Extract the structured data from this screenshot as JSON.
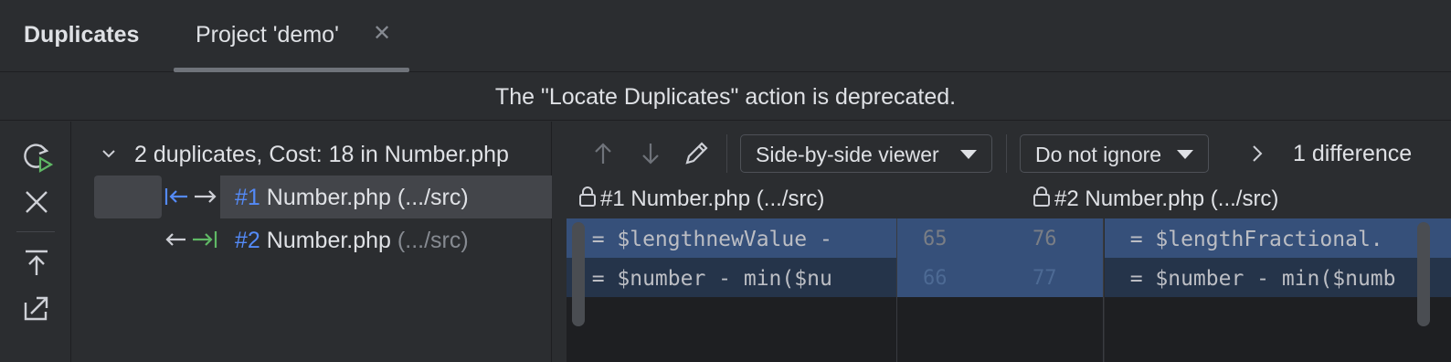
{
  "tool_window": {
    "title": "Duplicates",
    "tab": {
      "label": "Project 'demo'",
      "close_icon": "close-icon"
    }
  },
  "banner": {
    "text": "The \"Locate Duplicates\" action is deprecated."
  },
  "left_toolbar": {
    "icons": [
      "rerun-icon",
      "close-icon",
      "export-icon",
      "open-external-icon"
    ]
  },
  "tree": {
    "root": {
      "label": "2 duplicates, Cost: 18 in Number.php",
      "expanded": true
    },
    "items": [
      {
        "number": "#1",
        "file": "Number.php",
        "path": "(.../src)",
        "selected": true
      },
      {
        "number": "#2",
        "file": "Number.php",
        "path": "(.../src)",
        "selected": false
      }
    ]
  },
  "diff": {
    "toolbar": {
      "viewer": "Side-by-side viewer",
      "ignore": "Do not ignore",
      "count": "1 difference"
    },
    "left": {
      "header": "#1 Number.php (.../src)",
      "lines": [
        "  = $lengthnewValue - ",
        "  = $number - min($nu"
      ]
    },
    "right": {
      "header": "#2 Number.php (.../src)",
      "lines": [
        "  = $lengthFractional.",
        "  = $number - min($numb"
      ]
    },
    "gutter": [
      {
        "left": "65",
        "right": "76"
      },
      {
        "left": "66",
        "right": "77"
      }
    ]
  },
  "colors": {
    "accent": "#548af7",
    "diff_modified": "#36507a",
    "diff_line_bg": "#25344a"
  }
}
